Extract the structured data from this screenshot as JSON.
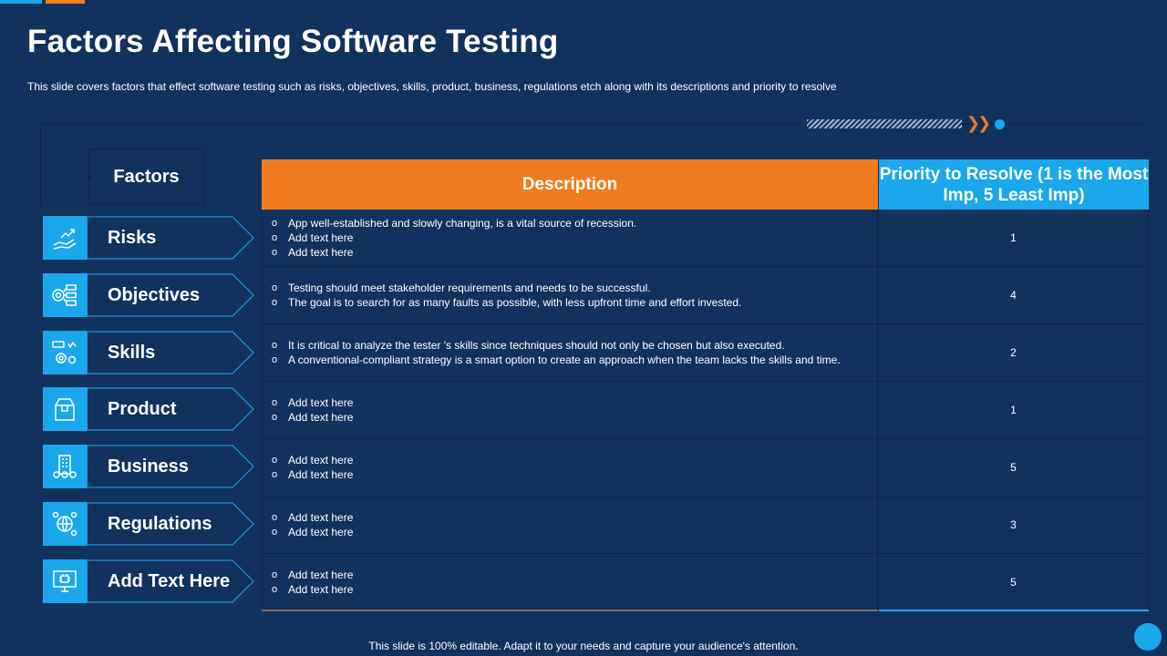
{
  "title": "Factors Affecting Software Testing",
  "subtitle": "This slide covers factors that effect software testing such as risks, objectives, skills, product, business, regulations etch along with its descriptions and priority to resolve",
  "colors": {
    "background": "#12325e",
    "accent_blue": "#1aa7ec",
    "accent_orange": "#f07c1f"
  },
  "factors_header": "Factors",
  "table_headers": {
    "description": "Description",
    "priority": "Priority to Resolve (1 is the Most Imp, 5 Least Imp)"
  },
  "bullet_marker": "o",
  "rows": [
    {
      "factor": "Risks",
      "icon": "hand-growth-icon",
      "bullets": [
        "App well-established and slowly changing, is a vital  source of recession.",
        "Add text here",
        "Add text here"
      ],
      "priority": "1"
    },
    {
      "factor": "Objectives",
      "icon": "target-list-icon",
      "bullets": [
        "Testing should meet stakeholder requirements and needs to be successful.",
        "The goal is to search for as many faults as possible, with less upfront time and effort invested."
      ],
      "priority": "4"
    },
    {
      "factor": "Skills",
      "icon": "gears-skills-icon",
      "bullets": [
        "It is critical to analyze the tester 's skills since techniques should not only be chosen but also executed.",
        "A conventional-compliant  strategy is a smart option to create an approach when the team lacks the skills and time."
      ],
      "priority": "2"
    },
    {
      "factor": "Product",
      "icon": "box-product-icon",
      "bullets": [
        "Add text here",
        "Add text here"
      ],
      "priority": "1"
    },
    {
      "factor": "Business",
      "icon": "building-business-icon",
      "bullets": [
        "Add text here",
        "Add text here"
      ],
      "priority": "5"
    },
    {
      "factor": "Regulations",
      "icon": "globe-regulations-icon",
      "bullets": [
        "Add text here",
        "Add text here"
      ],
      "priority": "3"
    },
    {
      "factor": "Add Text Here",
      "icon": "monitor-chip-icon",
      "bullets": [
        "Add text here",
        "Add text here"
      ],
      "priority": "5"
    }
  ],
  "footer": "This slide is 100% editable. Adapt it to your needs and capture your audience's attention."
}
